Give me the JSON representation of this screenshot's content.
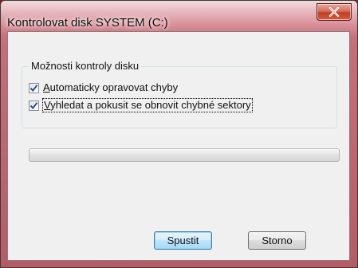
{
  "window": {
    "title": "Kontrolovat disk SYSTEM (C:)",
    "close_icon": "close-x-icon"
  },
  "options": {
    "group_label": "Možnosti kontroly disku",
    "items": [
      {
        "label": "Automaticky opravovat chyby",
        "accelerator": "A",
        "checked": true
      },
      {
        "label": "Vyhledat a pokusit se obnovit chybné sektory",
        "accelerator": "V",
        "checked": true
      }
    ]
  },
  "progress": {
    "value_percent": 0
  },
  "buttons": {
    "start": "Spustit",
    "cancel": "Storno"
  },
  "colors": {
    "accent_border": "#3c7fb1",
    "close_button": "#c33d22"
  }
}
